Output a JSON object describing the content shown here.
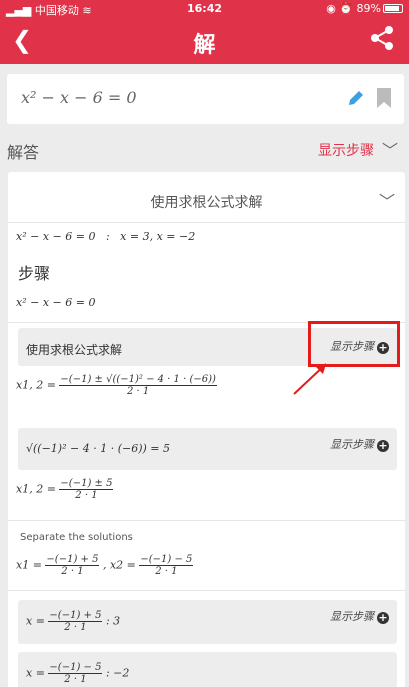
{
  "status": {
    "carrier": "中国移动",
    "time": "16:42",
    "battery": "89%",
    "battery_level": 0.89
  },
  "nav": {
    "title": "解"
  },
  "input": {
    "expression": "x² − x − 6 = 0"
  },
  "answer": {
    "label": "解答",
    "show_steps": "显示步骤"
  },
  "card": {
    "method_title": "使用求根公式求解",
    "result_equation": "x² − x − 6 = 0",
    "result_sep": ":",
    "result_values": "x = 3, x = −2",
    "steps_label": "步骤",
    "step_equation": "x² − x − 6 = 0",
    "step1_text": "使用求根公式求解",
    "step1_show": "显示步骤",
    "formula_lhs": "x1, 2 =",
    "formula_num": "−(−1) ± √((−1)² − 4 · 1 · (−6))",
    "formula_den": "2 · 1",
    "step2_expr": "√((−1)² − 4 · 1 · (−6)) = 5",
    "step2_show": "显示步骤",
    "formula2_lhs": "x1, 2 =",
    "formula2_num": "−(−1) ± 5",
    "formula2_den": "2 · 1",
    "separate_label": "Separate the solutions",
    "x1_lhs": "x1 =",
    "x1_num": "−(−1) + 5",
    "x1_den": "2 · 1",
    "x2_lhs": ", x2 =",
    "x2_num": "−(−1) − 5",
    "x2_den": "2 · 1",
    "step3_lhs": "x =",
    "step3_num": "−(−1) + 5",
    "step3_den": "2 · 1",
    "step3_result": ":  3",
    "step3_show": "显示步骤",
    "step4_lhs": "x =",
    "step4_num": "−(−1) − 5",
    "step4_den": "2 · 1",
    "step4_result": ":  −2"
  },
  "watermark": "",
  "colors": {
    "brand": "#e0334a",
    "highlight": "#e41b1b",
    "edit": "#3aa0e0"
  },
  "icons": [
    "back-arrow-icon",
    "share-icon",
    "pencil-icon",
    "bookmark-icon",
    "chevron-down-icon",
    "plus-circle-icon"
  ]
}
